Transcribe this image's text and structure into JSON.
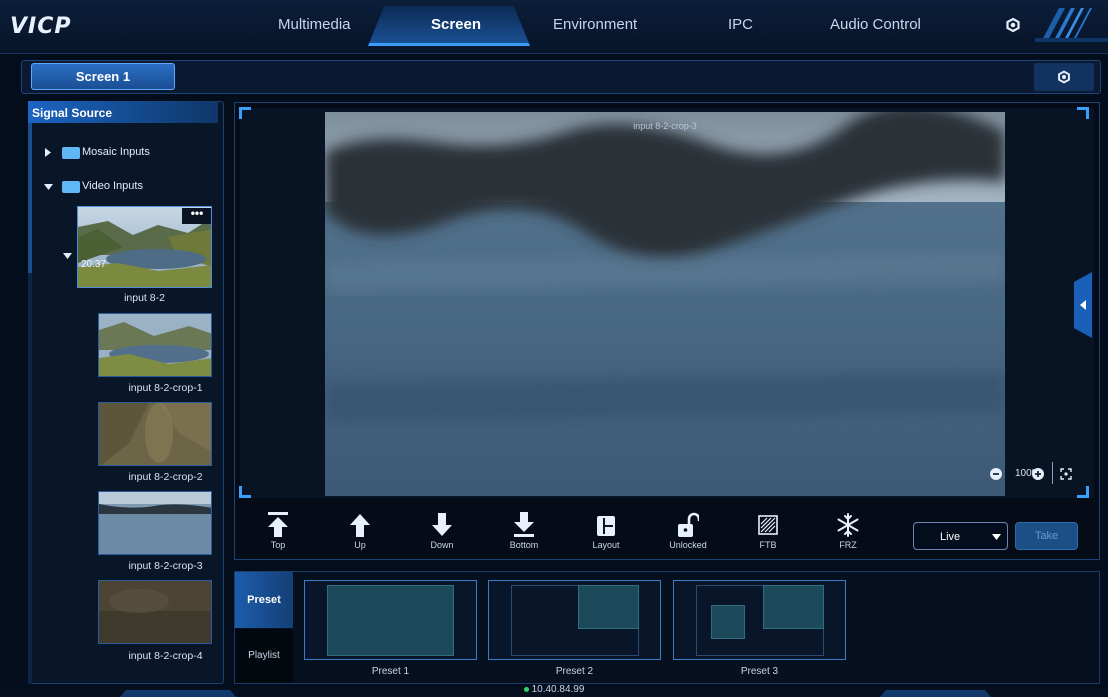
{
  "app": {
    "logo": "VICP"
  },
  "nav": {
    "tabs": [
      {
        "label": "Multimedia"
      },
      {
        "label": "Screen",
        "active": true
      },
      {
        "label": "Environment"
      },
      {
        "label": "IPC"
      },
      {
        "label": "Audio Control"
      }
    ],
    "settings_icon": "gear-icon"
  },
  "screen_bar": {
    "active_screen": "Screen 1",
    "settings_icon": "gear-icon"
  },
  "signal_source": {
    "title": "Signal Source",
    "folders": [
      {
        "label": "Mosaic Inputs",
        "expanded": false
      },
      {
        "label": "Video Inputs",
        "expanded": true
      }
    ],
    "inputs": [
      {
        "label": "input 8-2",
        "timestamp": "20:37"
      },
      {
        "label": "input 8-2-crop-1"
      },
      {
        "label": "input 8-2-crop-2"
      },
      {
        "label": "input 8-2-crop-3"
      },
      {
        "label": "input 8-2-crop-4"
      }
    ]
  },
  "preview": {
    "caption": "input 8-2-crop-3",
    "zoom": "100%"
  },
  "toolbar": {
    "tools": [
      {
        "label": "Top",
        "icon": "move-top-icon"
      },
      {
        "label": "Up",
        "icon": "arrow-up-icon"
      },
      {
        "label": "Down",
        "icon": "arrow-down-icon"
      },
      {
        "label": "Bottom",
        "icon": "move-bottom-icon"
      },
      {
        "label": "Layout",
        "icon": "layout-icon"
      },
      {
        "label": "Unlocked",
        "icon": "unlock-icon"
      },
      {
        "label": "FTB",
        "icon": "fade-to-black-icon"
      },
      {
        "label": "FRZ",
        "icon": "snowflake-icon"
      }
    ],
    "mode": "Live",
    "take_label": "Take"
  },
  "bottom": {
    "tabs": [
      {
        "label": "Preset",
        "active": true
      },
      {
        "label": "Playlist"
      }
    ],
    "presets": [
      {
        "label": "Preset 1"
      },
      {
        "label": "Preset 2"
      },
      {
        "label": "Preset 3"
      }
    ]
  },
  "status": {
    "ip": "10.40.84.99"
  },
  "colors": {
    "accent": "#3c9bff",
    "background": "#040d1c",
    "status_dot": "#32d26a"
  }
}
